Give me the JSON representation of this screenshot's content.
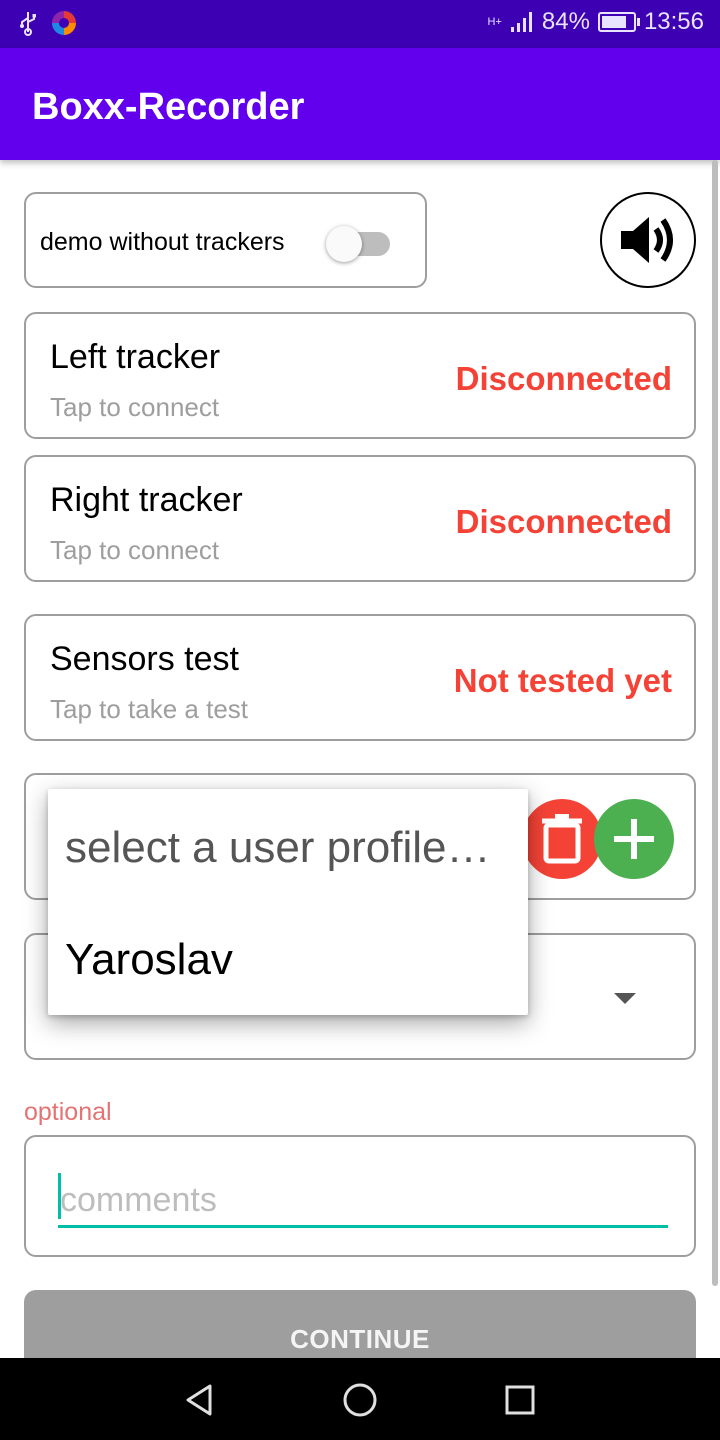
{
  "status_bar": {
    "network": "H+",
    "battery_percent": "84%",
    "time": "13:56",
    "icons": [
      "usb-icon",
      "app-notification-icon",
      "signal-icon",
      "battery-charging-icon"
    ]
  },
  "app_bar": {
    "title": "Boxx-Recorder"
  },
  "demo": {
    "label": "demo without trackers",
    "enabled": false
  },
  "sound_button": {
    "icon": "volume-icon"
  },
  "left_tracker": {
    "name": "Left tracker",
    "hint": "Tap to connect",
    "status": "Disconnected"
  },
  "right_tracker": {
    "name": "Right tracker",
    "hint": "Tap to connect",
    "status": "Disconnected"
  },
  "sensors_test": {
    "name": "Sensors test",
    "hint": "Tap to take a test",
    "status": "Not tested yet"
  },
  "profile": {
    "dropdown_options": [
      "select a user profile…",
      "Yaroslav"
    ],
    "delete_icon": "trash-icon",
    "add_icon": "plus-icon"
  },
  "optional_label": "optional",
  "comments": {
    "placeholder": "comments",
    "value": ""
  },
  "continue_button": {
    "label": "CONTINUE"
  },
  "colors": {
    "status_bar": "#3d00b3",
    "app_bar": "#6200ee",
    "error": "#f44336",
    "add": "#4caf50",
    "accent": "#00bfa5",
    "disabled_button": "#9e9e9e"
  }
}
